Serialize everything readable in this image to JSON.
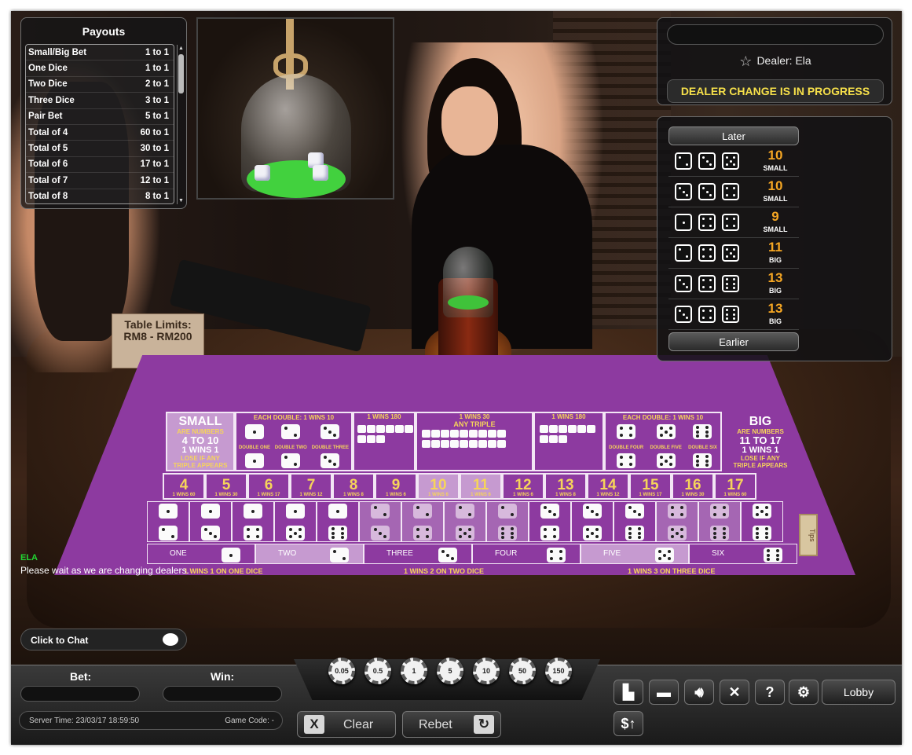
{
  "payouts": {
    "title": "Payouts",
    "rows": [
      {
        "name": "Small/Big Bet",
        "odds": "1 to 1"
      },
      {
        "name": "One Dice",
        "odds": "1 to 1"
      },
      {
        "name": "Two Dice",
        "odds": "2 to 1"
      },
      {
        "name": "Three Dice",
        "odds": "3 to 1"
      },
      {
        "name": "Pair Bet",
        "odds": "5 to 1"
      },
      {
        "name": "Total of 4",
        "odds": "60 to 1"
      },
      {
        "name": "Total of 5",
        "odds": "30 to 1"
      },
      {
        "name": "Total of 6",
        "odds": "17 to 1"
      },
      {
        "name": "Total of 7",
        "odds": "12 to 1"
      },
      {
        "name": "Total of 8",
        "odds": "8 to 1"
      }
    ]
  },
  "table_limits": {
    "line1": "Table Limits:",
    "line2": "RM8 - RM200"
  },
  "dealer": {
    "label": "Dealer: Ela",
    "status": "DEALER CHANGE IS IN PROGRESS"
  },
  "history": {
    "later_label": "Later",
    "earlier_label": "Earlier",
    "rows": [
      {
        "dice": [
          2,
          3,
          5
        ],
        "total": "10",
        "category": "SMALL"
      },
      {
        "dice": [
          3,
          3,
          4
        ],
        "total": "10",
        "category": "SMALL"
      },
      {
        "dice": [
          1,
          4,
          4
        ],
        "total": "9",
        "category": "SMALL"
      },
      {
        "dice": [
          2,
          4,
          5
        ],
        "total": "11",
        "category": "BIG"
      },
      {
        "dice": [
          3,
          4,
          6
        ],
        "total": "13",
        "category": "BIG"
      },
      {
        "dice": [
          3,
          4,
          6
        ],
        "total": "13",
        "category": "BIG"
      }
    ]
  },
  "table": {
    "small": {
      "title": "SMALL",
      "sub1": "ARE NUMBERS",
      "range": "4 TO 10",
      "wins": "1 WINS 1",
      "note1": "LOSE IF ANY",
      "note2": "TRIPLE APPEARS"
    },
    "big": {
      "title": "BIG",
      "sub1": "ARE NUMBERS",
      "range": "11 TO 17",
      "wins": "1 WINS 1",
      "note1": "LOSE IF ANY",
      "note2": "TRIPLE APPEARS"
    },
    "double_left_header": "EACH DOUBLE: 1 WINS 10",
    "double_right_header": "EACH DOUBLE: 1 WINS 10",
    "triple_left_header": "1 WINS 180",
    "any_triple_header": "1 WINS 30",
    "any_triple_label": "ANY TRIPLE",
    "triple_right_header": "1 WINS 180",
    "doubles_left": [
      "DOUBLE ONE",
      "DOUBLE TWO",
      "DOUBLE THREE"
    ],
    "doubles_right": [
      "DOUBLE FOUR",
      "DOUBLE FIVE",
      "DOUBLE SIX"
    ],
    "totals": [
      {
        "n": "4",
        "w": "1 WINS 60"
      },
      {
        "n": "5",
        "w": "1 WINS 30"
      },
      {
        "n": "6",
        "w": "1 WINS 17"
      },
      {
        "n": "7",
        "w": "1 WINS 12"
      },
      {
        "n": "8",
        "w": "1 WINS 8"
      },
      {
        "n": "9",
        "w": "1 WINS 6"
      },
      {
        "n": "10",
        "w": "1 WINS 6"
      },
      {
        "n": "11",
        "w": "1 WINS 6"
      },
      {
        "n": "12",
        "w": "1 WINS 6"
      },
      {
        "n": "13",
        "w": "1 WINS 8"
      },
      {
        "n": "14",
        "w": "1 WINS 12"
      },
      {
        "n": "15",
        "w": "1 WINS 17"
      },
      {
        "n": "16",
        "w": "1 WINS 30"
      },
      {
        "n": "17",
        "w": "1 WINS 60"
      }
    ],
    "singles": [
      "ONE",
      "TWO",
      "THREE",
      "FOUR",
      "FIVE",
      "SIX"
    ],
    "footer": [
      "1 WINS 1 ON ONE DICE",
      "1 WINS 2 ON TWO DICE",
      "1 WINS 3 ON THREE DICE"
    ],
    "tips_label": "Tips"
  },
  "chat": {
    "sender": "ELA",
    "message": "Please wait as we are changing dealers.",
    "button_label": "Click to Chat"
  },
  "toolbar": {
    "bet_label": "Bet:",
    "win_label": "Win:",
    "server_time": "Server Time: 23/03/17 18:59:50",
    "game_code": "Game Code: -",
    "chips": [
      "0.05",
      "0.5",
      "1",
      "5",
      "10",
      "50",
      "150"
    ],
    "clear_label": "Clear",
    "rebet_label": "Rebet",
    "lobby_label": "Lobby"
  },
  "colors": {
    "felt": "#8d3aa0",
    "gold": "#f6d45a",
    "history_total": "#f5a623",
    "chat_name": "#21d633",
    "dealer_status": "#f6e04a"
  }
}
